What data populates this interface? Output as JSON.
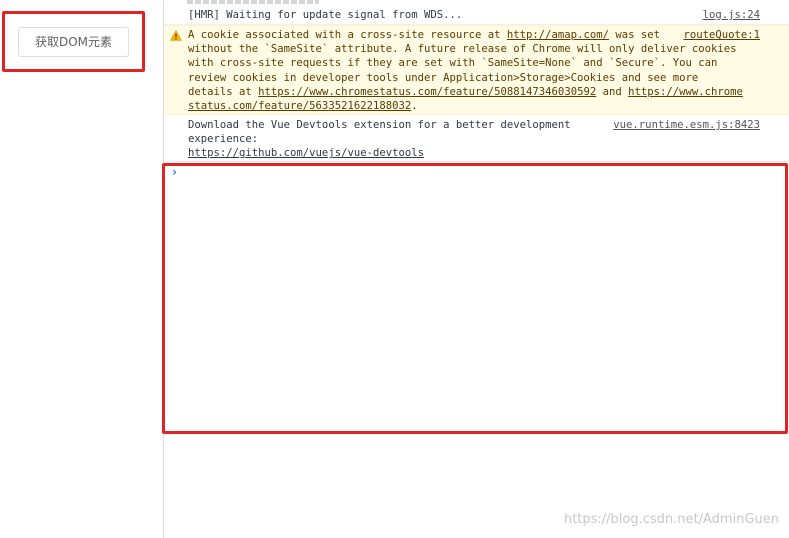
{
  "app": {
    "button_label": "获取DOM元素"
  },
  "console": {
    "messages": [
      {
        "type": "log",
        "text": "[HMR] Waiting for update signal from WDS...",
        "source": "log.js:24"
      },
      {
        "type": "warning",
        "text_before_link1": "A cookie associated with a cross-site resource at ",
        "link1": "http://amap.com/",
        "text_after_link1": " was set\nwithout the `SameSite` attribute. A future release of Chrome will only deliver cookies\nwith cross-site requests if they are set with `SameSite=None` and `Secure`. You can\nreview cookies in developer tools under Application>Storage>Cookies and see more\ndetails at ",
        "link2": "https://www.chromestatus.com/feature/5088147346030592",
        "text_and": " and ",
        "link3": "https://www.chrome\nstatus.com/feature/5633521622188032",
        "text_end": ".",
        "source": "routeQuote:1"
      },
      {
        "type": "log",
        "text": "Download the Vue Devtools extension for a better development\nexperience:\n",
        "link": "https://github.com/vuejs/vue-devtools",
        "source": "vue.runtime.esm.js:8423"
      }
    ],
    "prompt_symbol": "›"
  },
  "watermark": "https://blog.csdn.net/AdminGuen",
  "colors": {
    "highlight": "#e02424",
    "warning_bg": "#fffbe5",
    "prompt": "#367cf1"
  }
}
